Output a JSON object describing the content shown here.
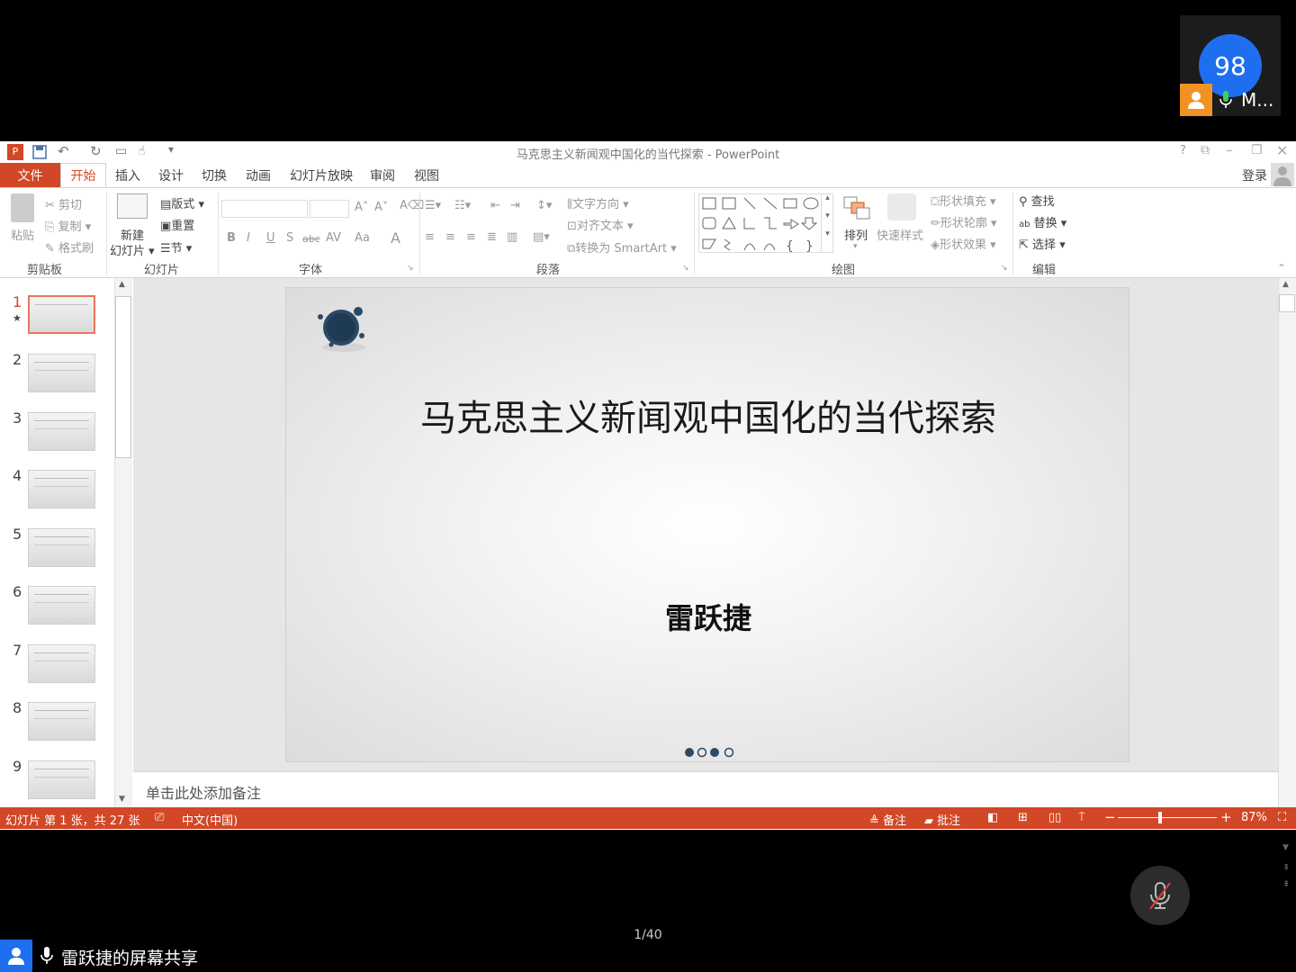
{
  "meeting": {
    "participant_count": "98",
    "participant_name": "M...",
    "page_counter": "1/40",
    "share_label": "雷跃捷的屏幕共享"
  },
  "window": {
    "title": "马克思主义新闻观中国化的当代探索 - PowerPoint",
    "help": "?",
    "login": "登录"
  },
  "tabs": [
    "文件",
    "开始",
    "插入",
    "设计",
    "切换",
    "动画",
    "幻灯片放映",
    "审阅",
    "视图"
  ],
  "ribbon": {
    "clipboard": {
      "paste": "粘贴",
      "cut": "剪切",
      "copy": "复制",
      "format_painter": "格式刷",
      "label": "剪贴板"
    },
    "slides": {
      "new_slide_1": "新建",
      "new_slide_2": "幻灯片",
      "layout": "版式",
      "reset": "重置",
      "section": "节",
      "label": "幻灯片"
    },
    "font": {
      "bold": "B",
      "italic": "I",
      "underline": "U",
      "shadow": "S",
      "strike": "abc",
      "spacing": "AV",
      "case": "Aa",
      "color": "A",
      "label": "字体"
    },
    "paragraph": {
      "text_direction": "文字方向",
      "align_text": "对齐文本",
      "smartart": "转换为 SmartArt",
      "label": "段落"
    },
    "drawing": {
      "arrange": "排列",
      "quick_styles": "快速样式",
      "shape_fill": "形状填充",
      "shape_outline": "形状轮廓",
      "shape_effects": "形状效果",
      "label": "绘图"
    },
    "editing": {
      "find": "查找",
      "replace": "替换",
      "select": "选择",
      "label": "编辑"
    }
  },
  "slide": {
    "title": "马克思主义新闻观中国化的当代探索",
    "author": "雷跃捷"
  },
  "thumbnails": [
    "1",
    "2",
    "3",
    "4",
    "5",
    "6",
    "7",
    "8",
    "9"
  ],
  "notes_placeholder": "单击此处添加备注",
  "status": {
    "slide_info": "幻灯片 第 1 张，共 27 张",
    "language": "中文(中国)",
    "notes": "备注",
    "comments": "批注",
    "zoom_minus": "−",
    "zoom_plus": "+",
    "zoom": "87%"
  },
  "colors": {
    "accent": "#d24726",
    "meeting_blue": "#1e6ff0",
    "badge_orange": "#f29222"
  }
}
